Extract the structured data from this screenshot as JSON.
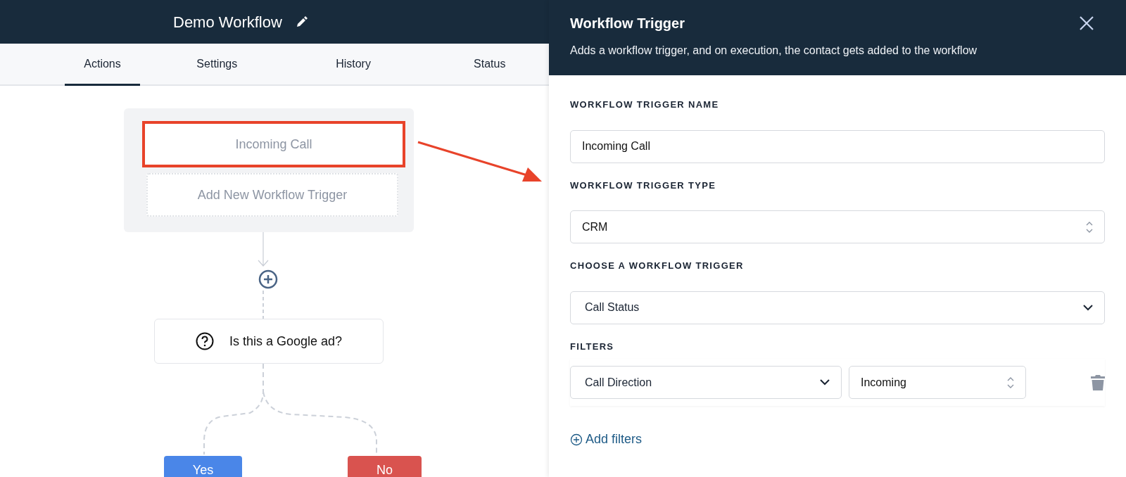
{
  "workflow": {
    "title": "Demo Workflow"
  },
  "tabs": [
    {
      "label": "Actions",
      "selected": true
    },
    {
      "label": "Settings",
      "selected": false
    },
    {
      "label": "History",
      "selected": false
    },
    {
      "label": "Status",
      "selected": false
    }
  ],
  "triggers": [
    {
      "kind": "trigger",
      "label": "Incoming Call",
      "highlighted": true
    },
    {
      "kind": "add",
      "label": "Add New Workflow Trigger",
      "highlighted": false
    }
  ],
  "condition": {
    "label": "Is this a Google ad?"
  },
  "branches": [
    {
      "label": "Yes",
      "color": "#4a86e8"
    },
    {
      "label": "No",
      "color": "#d9534f"
    }
  ],
  "panel": {
    "title": "Workflow Trigger",
    "subtitle": "Adds a workflow trigger, and on execution, the contact gets added to the workflow",
    "fields": [
      {
        "label": "WORKFLOW TRIGGER NAME",
        "kind": "text",
        "value": "Incoming Call"
      },
      {
        "label": "WORKFLOW TRIGGER TYPE",
        "kind": "updown",
        "value": "CRM"
      },
      {
        "label": "CHOOSE A WORKFLOW TRIGGER",
        "kind": "dropdown",
        "value": "Call Status"
      }
    ],
    "filters": {
      "label": "FILTERS",
      "rows": [
        {
          "controls": [
            {
              "kind": "dropdown",
              "value": "Call Direction"
            },
            {
              "kind": "updown",
              "value": "Incoming"
            }
          ]
        }
      ]
    },
    "add_filters": "Add filters"
  }
}
